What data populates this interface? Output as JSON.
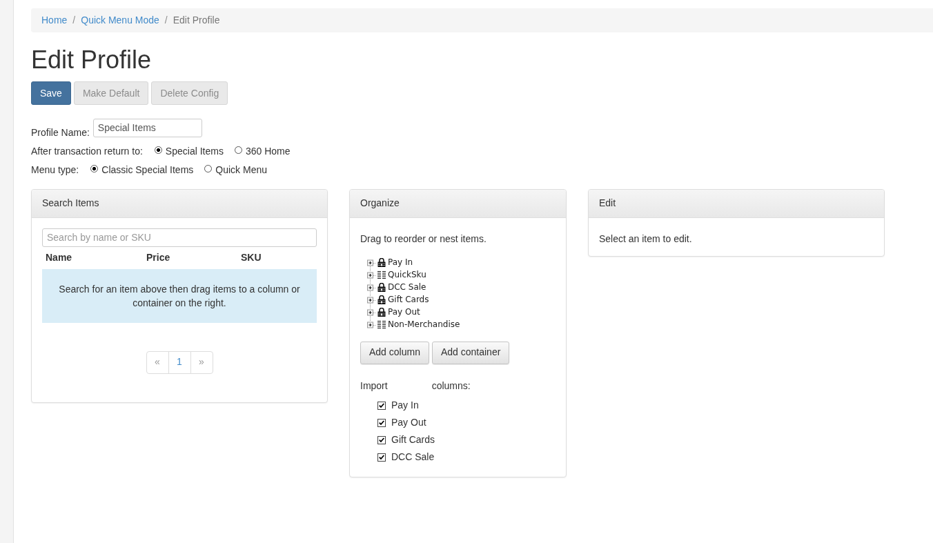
{
  "breadcrumb": {
    "separator": "/",
    "items": [
      {
        "label": "Home",
        "kind": "link"
      },
      {
        "label": "Quick Menu Mode",
        "kind": "link"
      },
      {
        "label": "Edit Profile",
        "kind": "current"
      }
    ]
  },
  "title": "Edit Profile",
  "actions": [
    {
      "label": "Save",
      "kind": "primary",
      "disabled": false
    },
    {
      "label": "Make Default",
      "kind": "default",
      "disabled": true
    },
    {
      "label": "Delete Config",
      "kind": "default",
      "disabled": true
    }
  ],
  "form": {
    "profile_name": {
      "label": "Profile Name:",
      "value": "Special Items"
    },
    "radio_groups": [
      {
        "label": "After transaction return to:",
        "options": [
          {
            "label": "Special Items",
            "selected": true
          },
          {
            "label": "360 Home",
            "selected": false
          }
        ]
      },
      {
        "label": "Menu type:",
        "options": [
          {
            "label": "Classic Special Items",
            "selected": true
          },
          {
            "label": "Quick Menu",
            "selected": false
          }
        ]
      }
    ]
  },
  "search_panel": {
    "title": "Search Items",
    "search": {
      "placeholder": "Search by name or SKU"
    },
    "columns": [
      "Name",
      "Price",
      "SKU"
    ],
    "empty_message": "Search for an item above then drag items to a column or container on the right.",
    "pagination": [
      {
        "label": "«",
        "disabled": true
      },
      {
        "label": "1",
        "disabled": false
      },
      {
        "label": "»",
        "disabled": true
      }
    ]
  },
  "organize_panel": {
    "title": "Organize",
    "hint": "Drag to reorder or nest items.",
    "tree": [
      {
        "label": "Pay In",
        "kind": "container",
        "expanded": false
      },
      {
        "label": "QuickSku",
        "kind": "column",
        "expanded": false
      },
      {
        "label": "DCC Sale",
        "kind": "container",
        "expanded": false
      },
      {
        "label": "Gift Cards",
        "kind": "container",
        "expanded": false
      },
      {
        "label": "Pay Out",
        "kind": "container",
        "expanded": false
      },
      {
        "label": "Non-Merchandise",
        "kind": "column",
        "expanded": false
      }
    ],
    "buttons": [
      "Add column",
      "Add container"
    ],
    "import_label": {
      "before": "Import",
      "after": "columns:"
    },
    "import_items": [
      {
        "label": "Pay In",
        "checked": true
      },
      {
        "label": "Pay Out",
        "checked": true
      },
      {
        "label": "Gift Cards",
        "checked": true
      },
      {
        "label": "DCC Sale",
        "checked": true
      }
    ]
  },
  "edit_panel": {
    "title": "Edit",
    "hint": "Select an item to edit."
  }
}
